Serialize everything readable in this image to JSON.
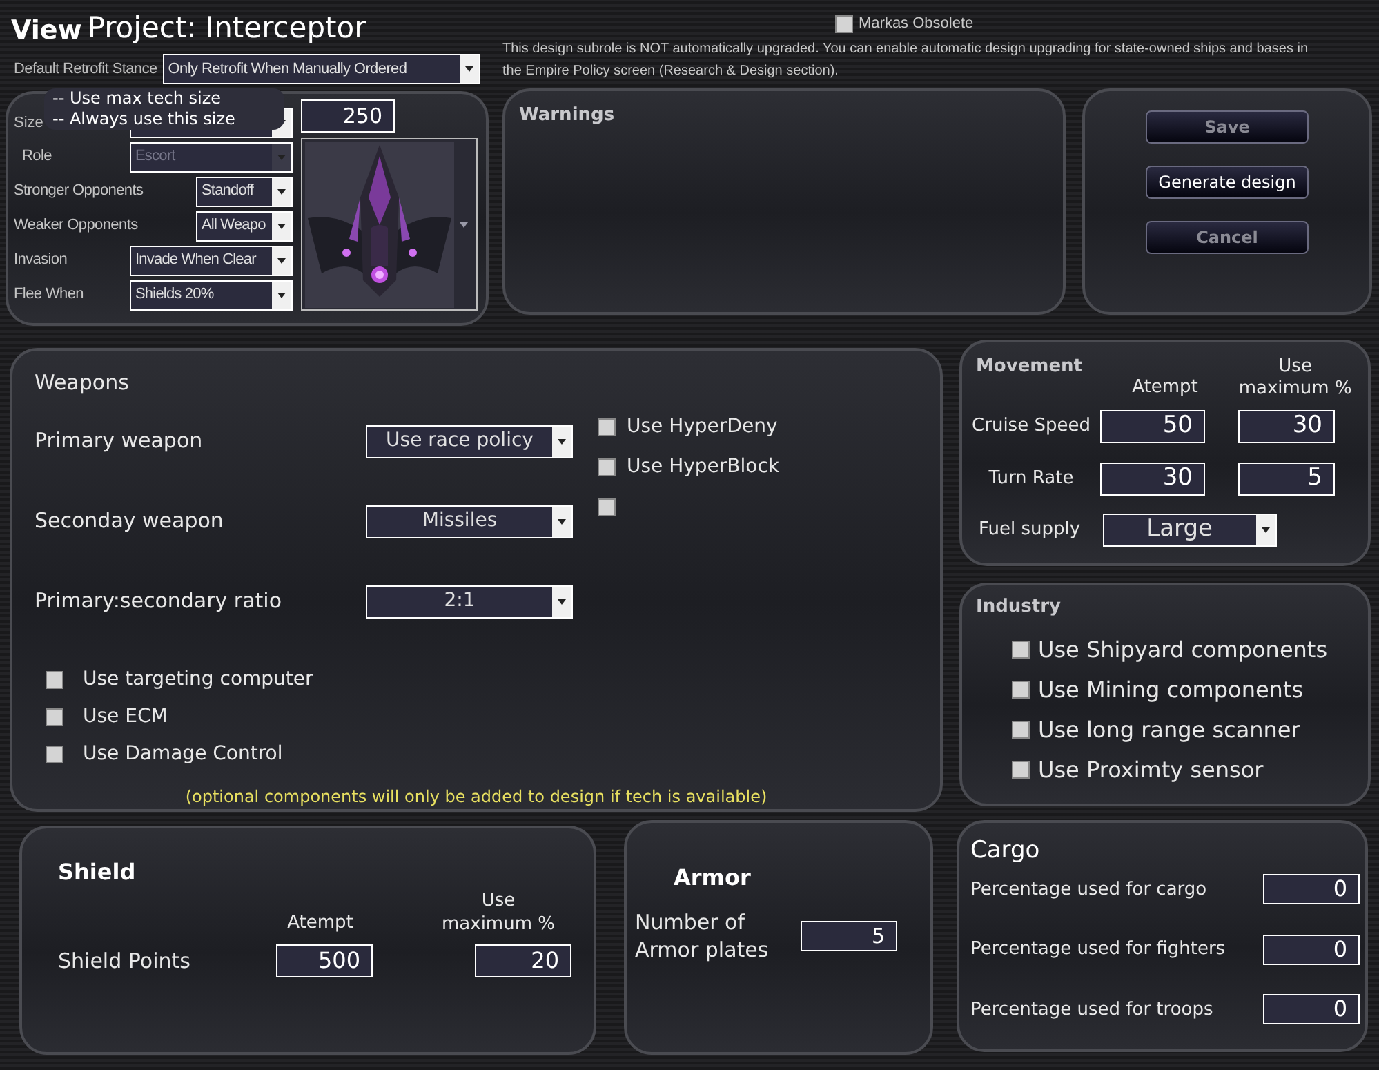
{
  "title": {
    "prefix": "View",
    "text": "Project: Interceptor"
  },
  "mark_obsolete": {
    "label": "Markas Obsolete",
    "checked": false
  },
  "notice": "This design subrole is NOT automatically upgraded. You can enable automatic design upgrading for state-owned ships and bases in the Empire Policy screen (Research & Design section).",
  "retrofit": {
    "label": "Default Retrofit Stance",
    "value": "Only Retrofit When Manually Ordered"
  },
  "size": {
    "label": "Size",
    "expanded": true,
    "options": [
      "-- Use max tech size",
      "-- Always use this size"
    ],
    "amount": "250"
  },
  "behaviour": [
    {
      "label": "Role",
      "value": "Escort",
      "disabled": true
    },
    {
      "label": "Stronger Opponents",
      "value": "Standoff",
      "disabled": false
    },
    {
      "label": "Weaker Opponents",
      "value": "All Weapo",
      "disabled": false
    },
    {
      "label": "Invasion",
      "value": "Invade When Clear",
      "disabled": false
    },
    {
      "label": "Flee When",
      "value": "Shields 20%",
      "disabled": false
    }
  ],
  "warnings": {
    "title": "Warnings"
  },
  "buttons": [
    {
      "label": "Save",
      "disabled": true
    },
    {
      "label": "Generate design",
      "disabled": false
    },
    {
      "label": "Cancel",
      "disabled": true
    }
  ],
  "weapons": {
    "title": "Weapons",
    "selects": [
      {
        "label": "Primary weapon",
        "value": "Use race policy"
      },
      {
        "label": "Seconday weapon",
        "value": "Missiles"
      },
      {
        "label": "Primary:secondary ratio",
        "value": "2:1"
      }
    ],
    "right_options": [
      {
        "label": "Use HyperDeny",
        "checked": false
      },
      {
        "label": "Use HyperBlock",
        "checked": false
      },
      {
        "checked": false
      }
    ],
    "options": [
      {
        "label": "Use targeting computer",
        "checked": false
      },
      {
        "label": "Use ECM",
        "checked": false
      },
      {
        "label": "Use Damage Control",
        "checked": false
      }
    ],
    "note": "(optional components will only be added to design if tech is available)"
  },
  "movement": {
    "title": "Movement",
    "columns": [
      "Atempt",
      "Use maximum %"
    ],
    "rows": [
      {
        "label": "Cruise Speed",
        "attempt": "50",
        "maximum": "30"
      },
      {
        "label": "Turn Rate",
        "attempt": "30",
        "maximum": "5"
      }
    ],
    "fuel": {
      "label": "Fuel supply",
      "value": "Large"
    }
  },
  "industry": {
    "title": "Industry",
    "options": [
      {
        "label": "Use Shipyard components",
        "checked": false
      },
      {
        "label": "Use Mining components",
        "checked": false
      },
      {
        "label": "Use long range scanner",
        "checked": false
      },
      {
        "label": "Use Proximty sensor",
        "checked": false
      }
    ]
  },
  "shield": {
    "title": "Shield",
    "columns": [
      "Atempt",
      "Use maximum %"
    ],
    "label": "Shield Points",
    "attempt": "500",
    "maximum": "20"
  },
  "armor": {
    "title": "Armor",
    "label": "Number of Armor plates",
    "value": "5"
  },
  "cargo": {
    "title": "Cargo",
    "rows": [
      {
        "label": "Percentage used for cargo",
        "value": "0"
      },
      {
        "label": "Percentage used for fighters",
        "value": "0"
      },
      {
        "label": "Percentage used for troops",
        "value": "0"
      }
    ]
  }
}
